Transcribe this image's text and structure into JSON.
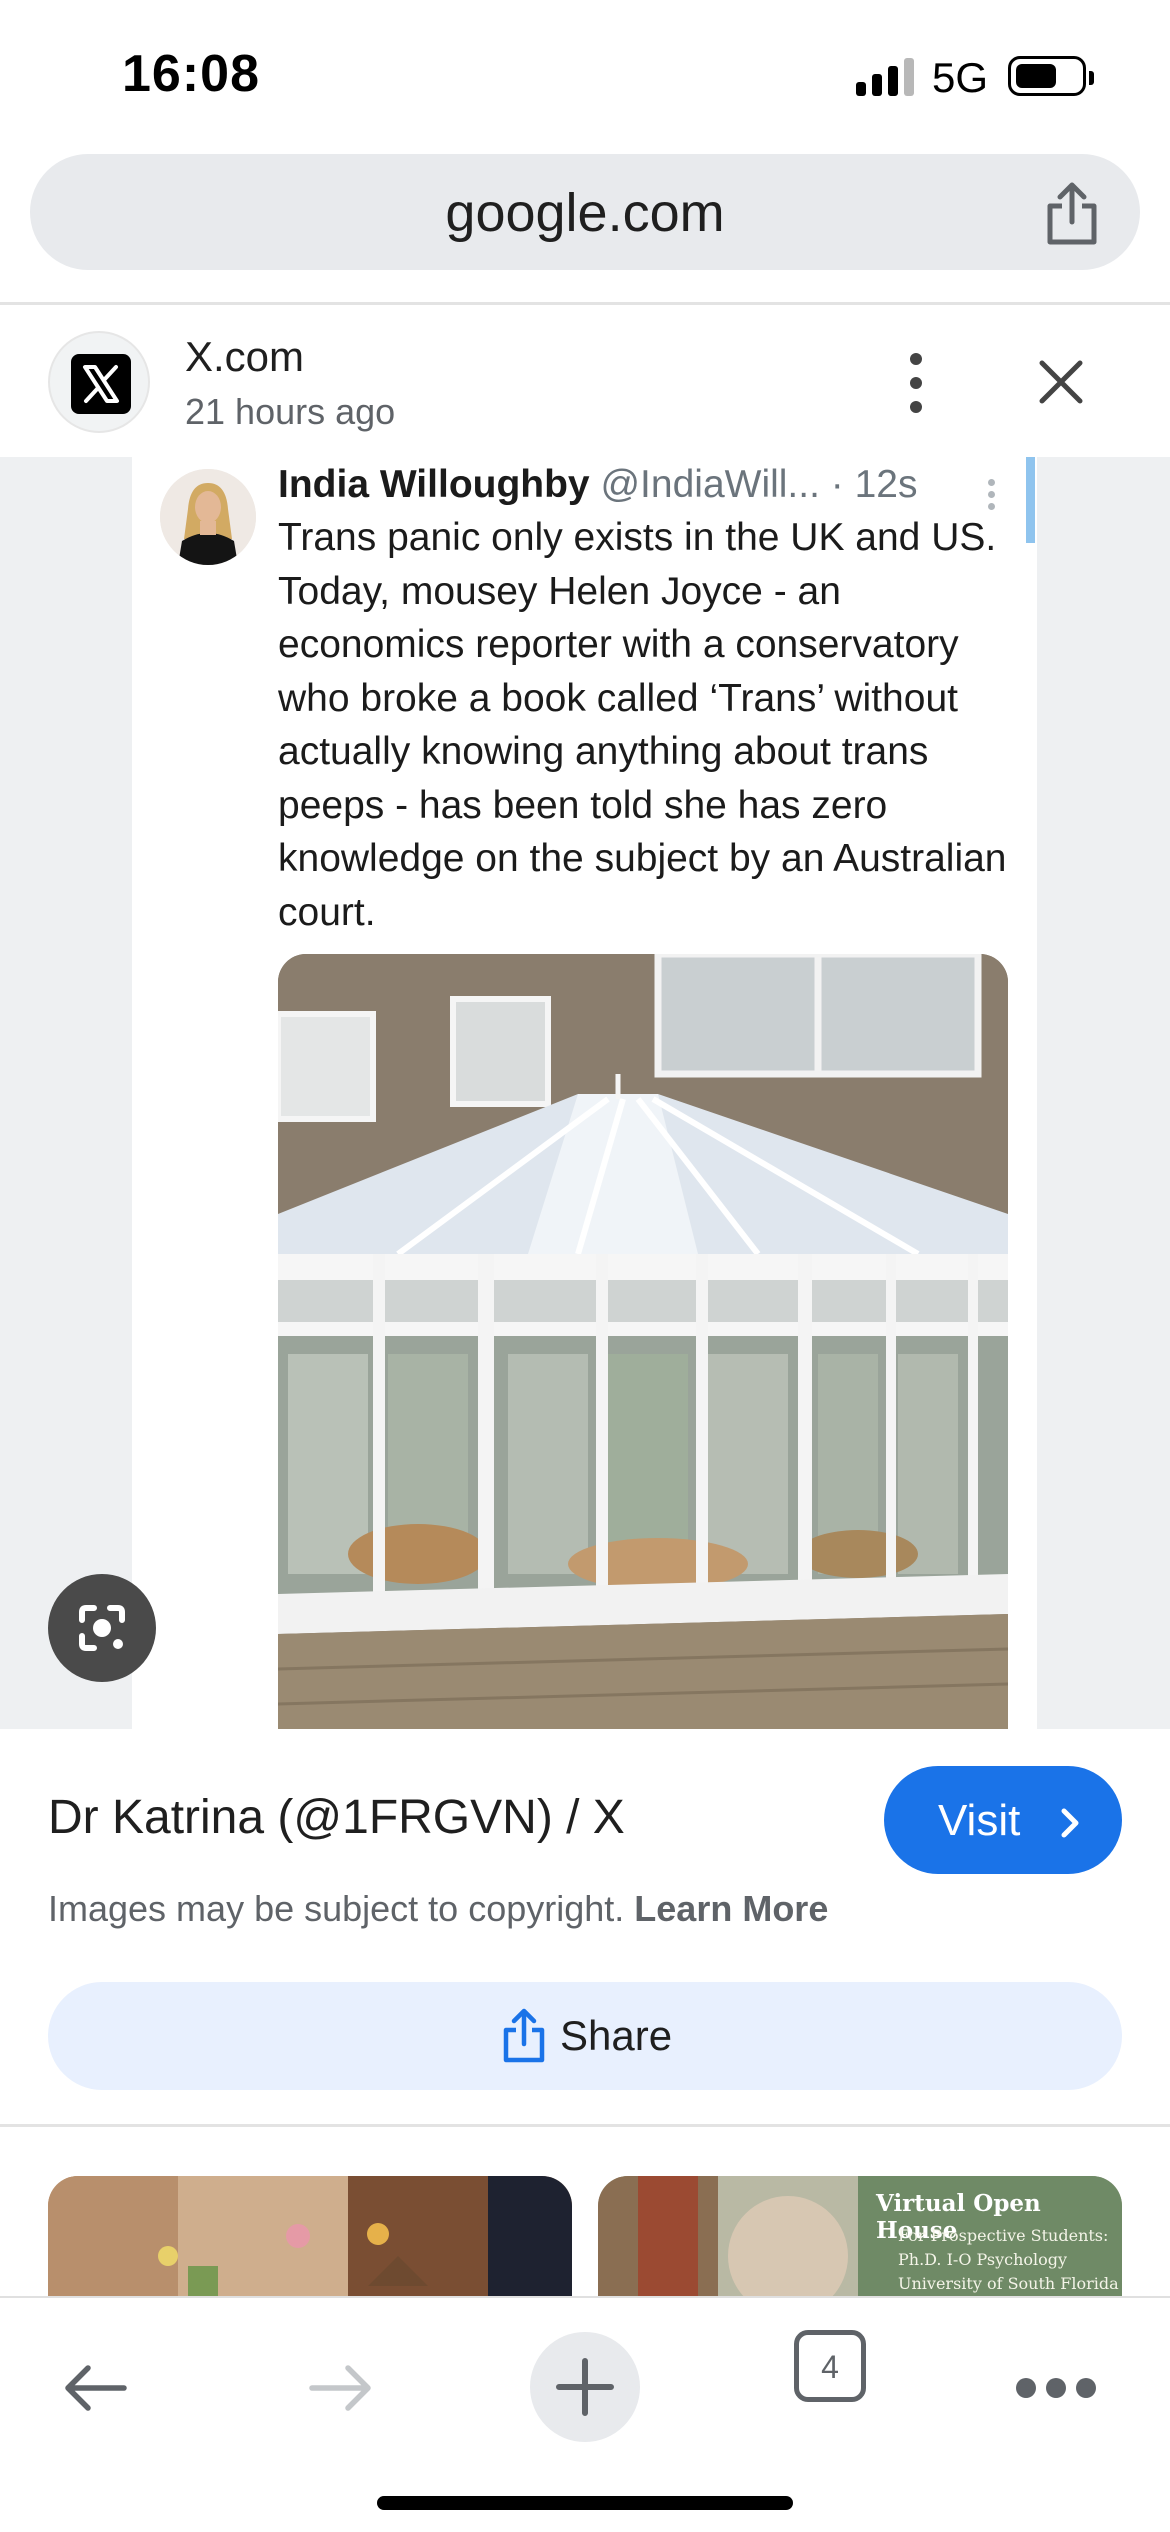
{
  "status_bar": {
    "time": "16:08",
    "network": "5G",
    "signal_bars_active": 3,
    "signal_bars_total": 4,
    "battery_level": 0.6,
    "signal_icon": "cellular-signal-icon",
    "battery_icon": "battery-icon"
  },
  "url_bar": {
    "domain": "google.com",
    "share_icon": "share-icon"
  },
  "source": {
    "site_name": "X.com",
    "age": "21 hours ago",
    "logo_icon": "x-logo-icon",
    "more_icon": "more-vertical-icon",
    "close_icon": "close-icon"
  },
  "tweet": {
    "author_name": "India Willoughby",
    "author_handle": "@IndiaWill...",
    "timestamp": "· 12s",
    "text": "Trans panic only exists in the UK and US. Today, mousey Helen Joyce - an economics reporter with a conservatory who broke a book called ‘Trans’ without actually knowing anything about trans peeps - has been told she has zero knowledge on the subject by an Australian court.",
    "photo_subject": "conservatory"
  },
  "lens_button": {
    "icon": "lens-search-icon"
  },
  "result": {
    "title": "Dr Katrina (@1FRGVN) / X",
    "visit_label": "Visit",
    "copyright_text": "Images may be subject to copyright.",
    "learn_more_label": "Learn More",
    "share_label": "Share"
  },
  "related": {
    "thumb2_title": "Virtual Open House",
    "thumb2_line1": "For Prospective Students:",
    "thumb2_line2": "Ph.D. I-O Psychology",
    "thumb2_line3": "University of South Florida"
  },
  "toolbar": {
    "back_icon": "arrow-left-icon",
    "forward_icon": "arrow-right-icon",
    "new_tab_icon": "plus-icon",
    "tab_count": "4",
    "more_icon": "more-horizontal-icon"
  },
  "colors": {
    "accent": "#1a73e8",
    "share_button_bg": "#e8f0fe",
    "url_bar_bg": "#e8eaed",
    "preview_bg": "#eef0f2"
  }
}
